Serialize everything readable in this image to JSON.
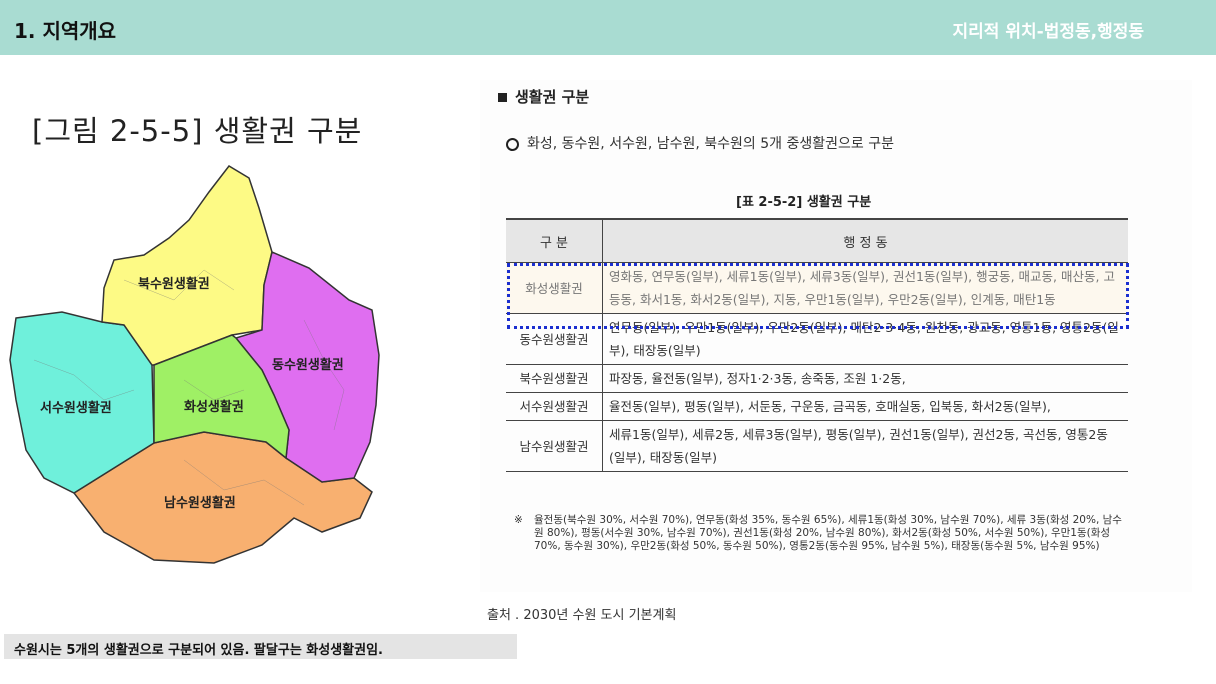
{
  "header": {
    "title": "1. 지역개요",
    "subtitle": "지리적 위치-법정동,행정동"
  },
  "figure": {
    "title": "[그림 2-5-5] 생활권 구분",
    "regions": {
      "north": "북수원생활권",
      "east": "동수원생활권",
      "west": "서수원생활권",
      "center": "화성생활권",
      "south": "남수원생활권"
    },
    "colors": {
      "north": "#fdfa85",
      "east": "#df6ef0",
      "west": "#6ff0db",
      "center": "#9ff065",
      "south": "#f8b070"
    }
  },
  "section": {
    "heading": "생활권 구분",
    "bullet": "화성, 동수원, 서수원, 남수원, 북수원의 5개 중생활권으로 구분"
  },
  "table": {
    "caption": "[표 2-5-2] 생활권 구분",
    "headers": [
      "구 분",
      "행 정 동"
    ],
    "rows": [
      {
        "name": "화성생활권",
        "dongs": "영화동, 연무동(일부), 세류1동(일부), 세류3동(일부), 권선1동(일부), 행궁동, 매교동, 매산동, 고등동, 화서1동, 화서2동(일부), 지동, 우만1동(일부), 우만2동(일부), 인계동, 매탄1동"
      },
      {
        "name": "동수원생활권",
        "dongs": "연무동(일부), 우만1동(일부), 우만2동(일부), 매탄2·3·4동, 원천동, 광교동, 영통1동, 영통2동(일부), 태장동(일부)"
      },
      {
        "name": "북수원생활권",
        "dongs": "파장동, 율전동(일부), 정자1·2·3동, 송죽동, 조원 1·2동,"
      },
      {
        "name": "서수원생활권",
        "dongs": "율전동(일부), 평동(일부), 서둔동, 구운동, 금곡동, 호매실동, 입북동, 화서2동(일부),"
      },
      {
        "name": "남수원생활권",
        "dongs": "세류1동(일부), 세류2동, 세류3동(일부), 평동(일부), 권선1동(일부), 권선2동, 곡선동, 영통2동(일부), 태장동(일부)"
      }
    ],
    "note_mark": "※",
    "note": "율전동(북수원 30%, 서수원 70%), 연무동(화성 35%, 동수원 65%), 세류1동(화성 30%, 남수원 70%), 세류 3동(화성 20%, 남수원 80%), 평동(서수원 30%, 남수원 70%), 권선1동(화성 20%, 남수원 80%), 화서2동(화성 50%, 서수원 50%), 우만1동(화성 70%, 동수원 30%), 우만2동(화성 50%, 동수원 50%), 영통2동(동수원 95%, 남수원 5%), 태장동(동수원 5%, 남수원 95%)"
  },
  "source": "출처 . 2030년 수원 도시 기본계획",
  "caption": "수원시는 5개의 생활권으로 구분되어 있음. 팔달구는 화성생활권임."
}
